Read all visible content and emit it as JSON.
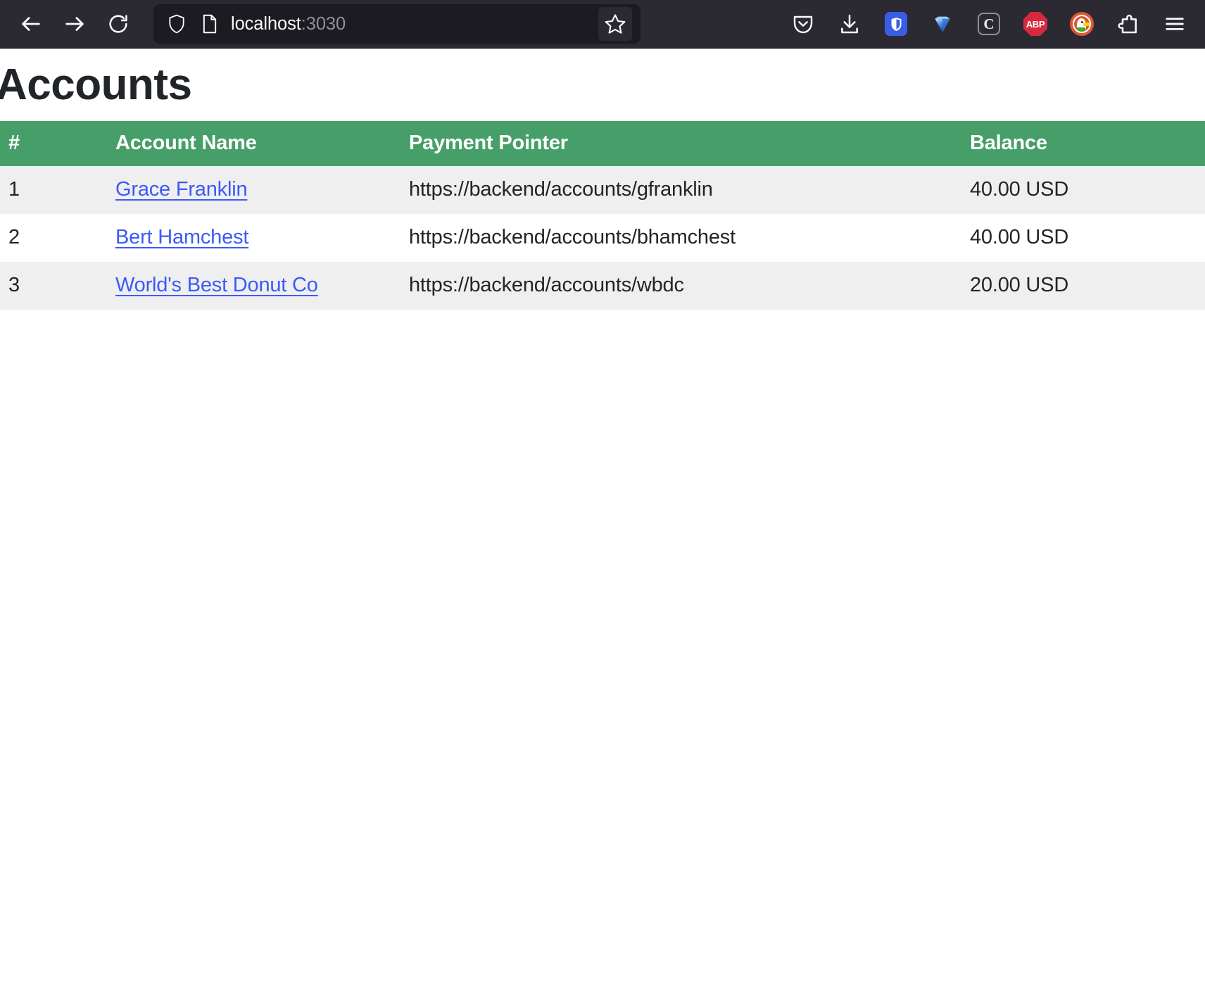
{
  "browser": {
    "nav": {
      "back_icon": "arrow-left-icon",
      "forward_icon": "arrow-right-icon",
      "reload_icon": "reload-icon"
    },
    "urlbar": {
      "shield_icon": "shield-icon",
      "page_icon": "page-document-icon",
      "url_host": "localhost",
      "url_port": ":3030",
      "bookmark_icon": "star-outline-icon"
    },
    "extensions": [
      {
        "name": "pocket-icon",
        "label": ""
      },
      {
        "name": "downloads-icon",
        "label": ""
      },
      {
        "name": "bitwarden-icon",
        "label": ""
      },
      {
        "name": "gem-icon",
        "label": ""
      },
      {
        "name": "cookie-autodelete-icon",
        "label": "C"
      },
      {
        "name": "adblock-plus-icon",
        "label": "ABP"
      },
      {
        "name": "duckduckgo-icon",
        "label": ""
      },
      {
        "name": "extensions-puzzle-icon",
        "label": ""
      },
      {
        "name": "app-menu-icon",
        "label": ""
      }
    ]
  },
  "page": {
    "title": "Accounts",
    "table": {
      "columns": [
        "#",
        "Account Name",
        "Payment Pointer",
        "Balance"
      ],
      "rows": [
        {
          "num": "1",
          "name": "Grace Franklin",
          "pointer": "https://backend/accounts/gfranklin",
          "balance": "40.00 USD"
        },
        {
          "num": "2",
          "name": "Bert Hamchest",
          "pointer": "https://backend/accounts/bhamchest",
          "balance": "40.00 USD"
        },
        {
          "num": "3",
          "name": "World's Best Donut Co",
          "pointer": "https://backend/accounts/wbdc",
          "balance": "20.00 USD"
        }
      ]
    }
  },
  "colors": {
    "table_header_green": "#469f68",
    "link_blue": "#3b5bf5",
    "row_stripe": "#efefef",
    "chrome_bg": "#2b2a33",
    "urlbar_bg": "#1c1b22"
  }
}
